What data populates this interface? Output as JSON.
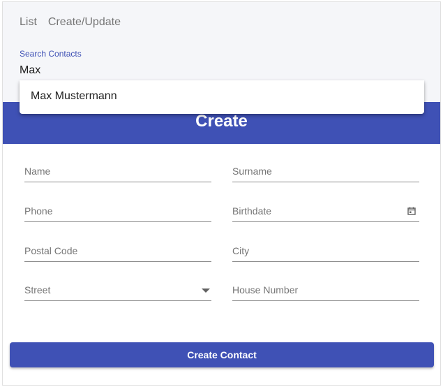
{
  "nav": {
    "items": [
      {
        "label": "List"
      },
      {
        "label": "Create/Update"
      }
    ]
  },
  "search": {
    "label": "Search Contacts",
    "value": "Max",
    "suggestions": [
      "Max Mustermann"
    ]
  },
  "form": {
    "title": "Create",
    "fields": {
      "name": "Name",
      "surname": "Surname",
      "phone": "Phone",
      "birthdate": "Birthdate",
      "postal_code": "Postal Code",
      "city": "City",
      "street": "Street",
      "house_number": "House Number"
    },
    "submit_label": "Create Contact"
  },
  "colors": {
    "primary": "#3f51b5",
    "label_accent": "#3f51b5",
    "muted_text": "#757575"
  },
  "icons": {
    "birthdate": "calendar-icon",
    "street": "dropdown-arrow-icon"
  }
}
